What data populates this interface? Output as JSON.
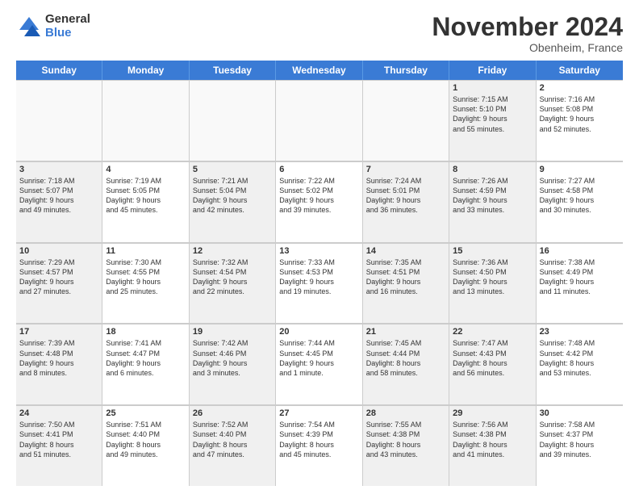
{
  "logo": {
    "general": "General",
    "blue": "Blue"
  },
  "title": "November 2024",
  "subtitle": "Obenheim, France",
  "days": [
    "Sunday",
    "Monday",
    "Tuesday",
    "Wednesday",
    "Thursday",
    "Friday",
    "Saturday"
  ],
  "rows": [
    [
      {
        "day": "",
        "info": "",
        "empty": true
      },
      {
        "day": "",
        "info": "",
        "empty": true
      },
      {
        "day": "",
        "info": "",
        "empty": true
      },
      {
        "day": "",
        "info": "",
        "empty": true
      },
      {
        "day": "",
        "info": "",
        "empty": true
      },
      {
        "day": "1",
        "info": "Sunrise: 7:15 AM\nSunset: 5:10 PM\nDaylight: 9 hours\nand 55 minutes.",
        "shaded": true
      },
      {
        "day": "2",
        "info": "Sunrise: 7:16 AM\nSunset: 5:08 PM\nDaylight: 9 hours\nand 52 minutes."
      }
    ],
    [
      {
        "day": "3",
        "info": "Sunrise: 7:18 AM\nSunset: 5:07 PM\nDaylight: 9 hours\nand 49 minutes.",
        "shaded": true
      },
      {
        "day": "4",
        "info": "Sunrise: 7:19 AM\nSunset: 5:05 PM\nDaylight: 9 hours\nand 45 minutes."
      },
      {
        "day": "5",
        "info": "Sunrise: 7:21 AM\nSunset: 5:04 PM\nDaylight: 9 hours\nand 42 minutes.",
        "shaded": true
      },
      {
        "day": "6",
        "info": "Sunrise: 7:22 AM\nSunset: 5:02 PM\nDaylight: 9 hours\nand 39 minutes."
      },
      {
        "day": "7",
        "info": "Sunrise: 7:24 AM\nSunset: 5:01 PM\nDaylight: 9 hours\nand 36 minutes.",
        "shaded": true
      },
      {
        "day": "8",
        "info": "Sunrise: 7:26 AM\nSunset: 4:59 PM\nDaylight: 9 hours\nand 33 minutes.",
        "shaded": true
      },
      {
        "day": "9",
        "info": "Sunrise: 7:27 AM\nSunset: 4:58 PM\nDaylight: 9 hours\nand 30 minutes."
      }
    ],
    [
      {
        "day": "10",
        "info": "Sunrise: 7:29 AM\nSunset: 4:57 PM\nDaylight: 9 hours\nand 27 minutes.",
        "shaded": true
      },
      {
        "day": "11",
        "info": "Sunrise: 7:30 AM\nSunset: 4:55 PM\nDaylight: 9 hours\nand 25 minutes."
      },
      {
        "day": "12",
        "info": "Sunrise: 7:32 AM\nSunset: 4:54 PM\nDaylight: 9 hours\nand 22 minutes.",
        "shaded": true
      },
      {
        "day": "13",
        "info": "Sunrise: 7:33 AM\nSunset: 4:53 PM\nDaylight: 9 hours\nand 19 minutes."
      },
      {
        "day": "14",
        "info": "Sunrise: 7:35 AM\nSunset: 4:51 PM\nDaylight: 9 hours\nand 16 minutes.",
        "shaded": true
      },
      {
        "day": "15",
        "info": "Sunrise: 7:36 AM\nSunset: 4:50 PM\nDaylight: 9 hours\nand 13 minutes.",
        "shaded": true
      },
      {
        "day": "16",
        "info": "Sunrise: 7:38 AM\nSunset: 4:49 PM\nDaylight: 9 hours\nand 11 minutes."
      }
    ],
    [
      {
        "day": "17",
        "info": "Sunrise: 7:39 AM\nSunset: 4:48 PM\nDaylight: 9 hours\nand 8 minutes.",
        "shaded": true
      },
      {
        "day": "18",
        "info": "Sunrise: 7:41 AM\nSunset: 4:47 PM\nDaylight: 9 hours\nand 6 minutes."
      },
      {
        "day": "19",
        "info": "Sunrise: 7:42 AM\nSunset: 4:46 PM\nDaylight: 9 hours\nand 3 minutes.",
        "shaded": true
      },
      {
        "day": "20",
        "info": "Sunrise: 7:44 AM\nSunset: 4:45 PM\nDaylight: 9 hours\nand 1 minute."
      },
      {
        "day": "21",
        "info": "Sunrise: 7:45 AM\nSunset: 4:44 PM\nDaylight: 8 hours\nand 58 minutes.",
        "shaded": true
      },
      {
        "day": "22",
        "info": "Sunrise: 7:47 AM\nSunset: 4:43 PM\nDaylight: 8 hours\nand 56 minutes.",
        "shaded": true
      },
      {
        "day": "23",
        "info": "Sunrise: 7:48 AM\nSunset: 4:42 PM\nDaylight: 8 hours\nand 53 minutes."
      }
    ],
    [
      {
        "day": "24",
        "info": "Sunrise: 7:50 AM\nSunset: 4:41 PM\nDaylight: 8 hours\nand 51 minutes.",
        "shaded": true
      },
      {
        "day": "25",
        "info": "Sunrise: 7:51 AM\nSunset: 4:40 PM\nDaylight: 8 hours\nand 49 minutes."
      },
      {
        "day": "26",
        "info": "Sunrise: 7:52 AM\nSunset: 4:40 PM\nDaylight: 8 hours\nand 47 minutes.",
        "shaded": true
      },
      {
        "day": "27",
        "info": "Sunrise: 7:54 AM\nSunset: 4:39 PM\nDaylight: 8 hours\nand 45 minutes."
      },
      {
        "day": "28",
        "info": "Sunrise: 7:55 AM\nSunset: 4:38 PM\nDaylight: 8 hours\nand 43 minutes.",
        "shaded": true
      },
      {
        "day": "29",
        "info": "Sunrise: 7:56 AM\nSunset: 4:38 PM\nDaylight: 8 hours\nand 41 minutes.",
        "shaded": true
      },
      {
        "day": "30",
        "info": "Sunrise: 7:58 AM\nSunset: 4:37 PM\nDaylight: 8 hours\nand 39 minutes."
      }
    ]
  ]
}
